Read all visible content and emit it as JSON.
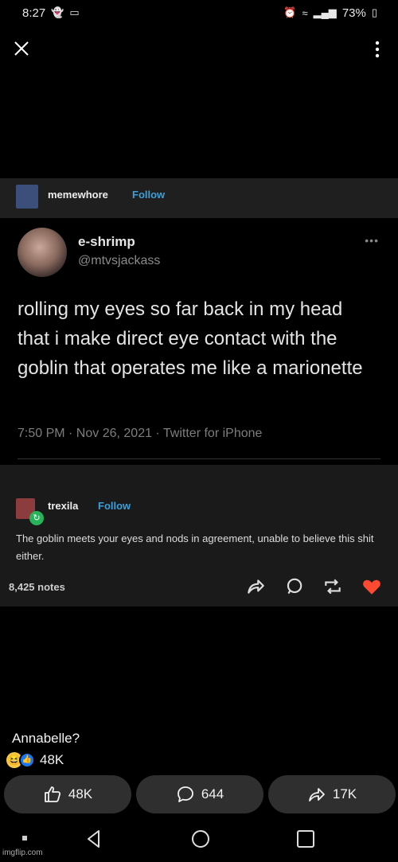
{
  "status_bar": {
    "time": "8:27",
    "battery": "73%"
  },
  "post_image": {
    "poster": {
      "name": "memewhore",
      "follow_label": "Follow"
    },
    "tweet": {
      "name": "e-shrimp",
      "handle": "@mtvsjackass",
      "text": "rolling my eyes so far back in my head that i make direct eye contact with the goblin that operates me like a marionette",
      "meta": "7:50 PM · Nov 26, 2021 · Twitter for iPhone",
      "more": "•••"
    },
    "reblog": {
      "name": "trexila",
      "follow_label": "Follow",
      "text": "The goblin meets your eyes and nods in agreement, unable to believe this shit either.",
      "notes": "8,425 notes"
    }
  },
  "caption": "Annabelle?",
  "reactions": {
    "count": "48K"
  },
  "actions": {
    "like": "48K",
    "comment": "644",
    "share": "17K"
  },
  "watermark": "imgflip.com",
  "colors": {
    "follow": "#3c9fd9",
    "heart": "#ff4930",
    "like_blue": "#1877f2"
  }
}
